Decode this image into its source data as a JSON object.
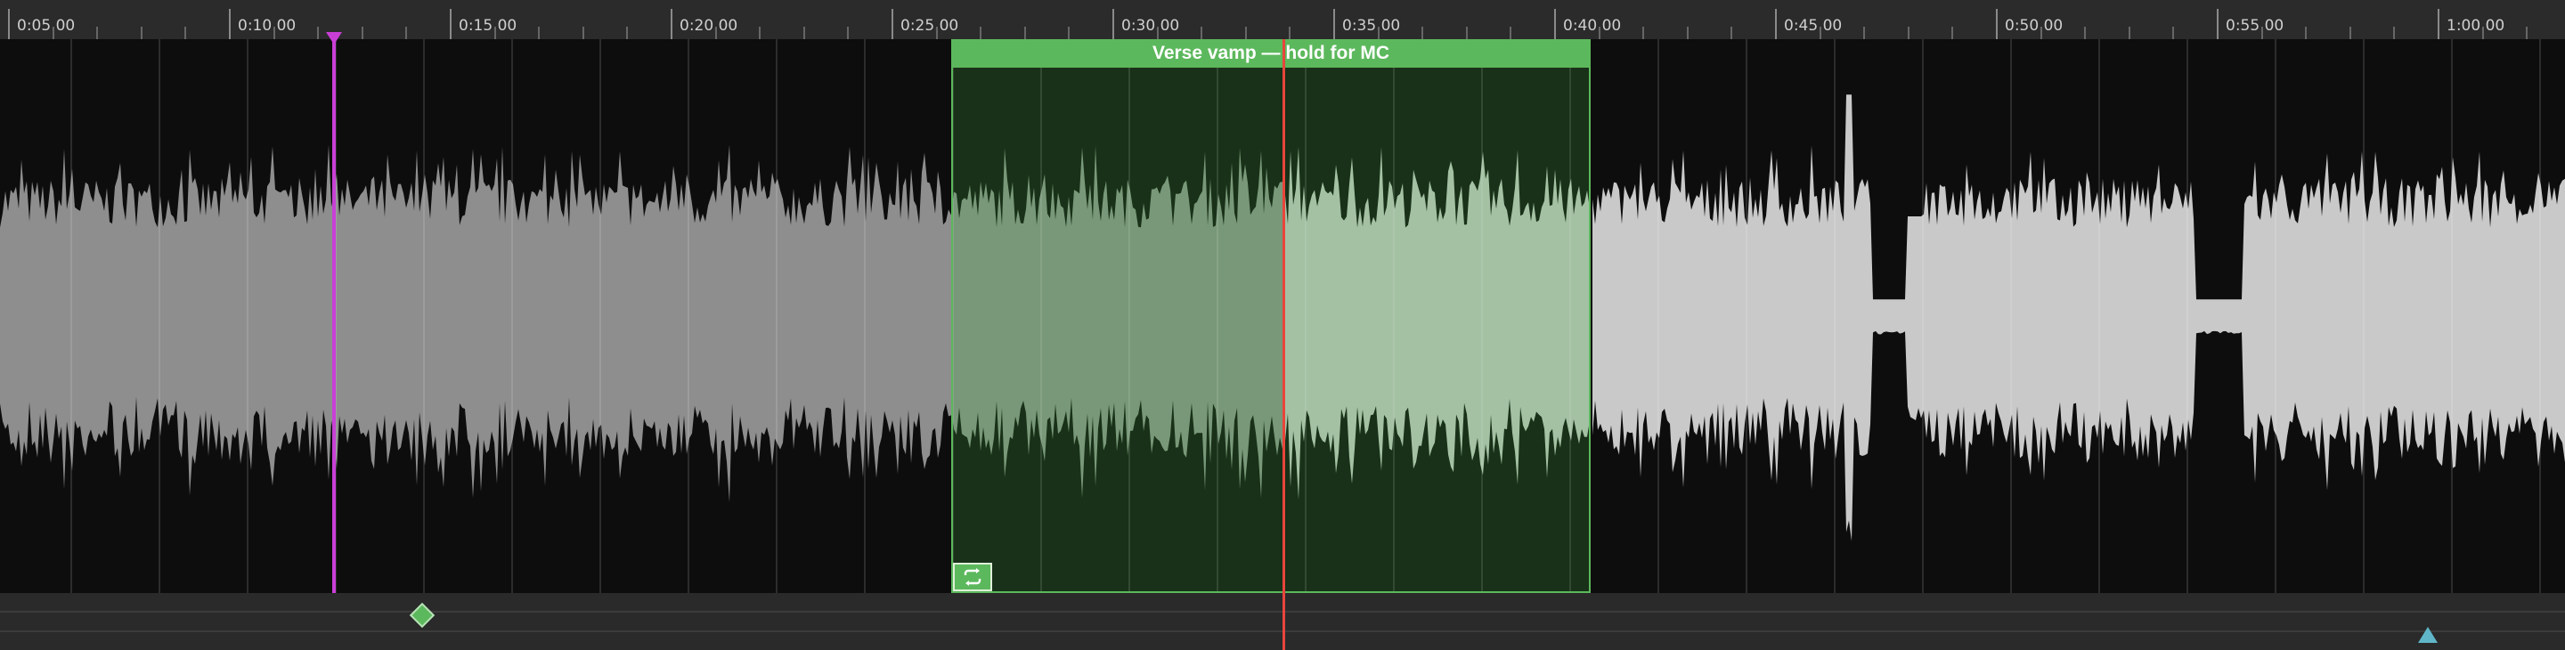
{
  "timeline": {
    "ruler_labels": [
      "0:05.00",
      "0:10.00",
      "0:15.00",
      "0:20.00",
      "0:25.00",
      "0:30.00",
      "0:35.00",
      "0:40.00",
      "0:45.00",
      "0:50.00",
      "0:55.00",
      "1:00.00"
    ]
  },
  "region": {
    "label": "Verse vamp — hold for MC",
    "color": "#5cb85c",
    "loop_icon": "loop-icon"
  },
  "markers": {
    "diamond": {
      "icon": "diamond-marker-icon",
      "color": "#5cb85c"
    },
    "triangle": {
      "icon": "triangle-marker-icon",
      "color": "#5fb6c8"
    }
  },
  "playheads": {
    "purple": {
      "color": "#c93fd6"
    },
    "red": {
      "color": "#e8453c"
    }
  }
}
